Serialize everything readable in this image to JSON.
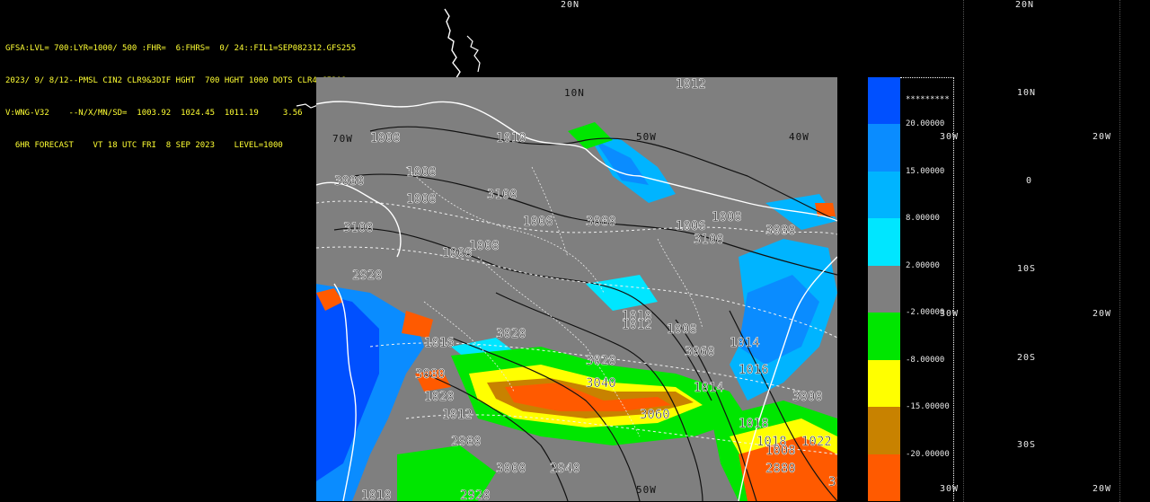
{
  "header": {
    "line1": "GFSA:LVL= 700:LYR=1000/ 500 :FHR=  6:FHRS=  0/ 24::FIL1=SEP082312.GFS255",
    "line2": "2023/ 9/ 8/12--PMSL CIN2 CLR9&3DIF HGHT  700 HGHT 1000 DOTS CLR4 CI20&",
    "line3": "V:WNG-V32    --N/X/MN/SD=  1003.92  1024.45  1011.19     3.56",
    "line4": "  6HR FORECAST    VT 18 UTC FRI  8 SEP 2023    LEVEL=1000"
  },
  "geo_labels": {
    "top_20n_a": "20N",
    "top_20n_b": "20N",
    "map_10n": "10N",
    "map_70w": "70W",
    "map_50w": "50W",
    "map_40w": "40W",
    "map_50w_bottom": "50W",
    "right_10n": "10N",
    "right_30w_a": "30W",
    "right_20w_a": "20W",
    "right_0": "0",
    "right_10s": "10S",
    "right_30w_b": "30W",
    "right_20w_b": "20W",
    "right_20s": "20S",
    "right_30s": "30S",
    "right_30w_c": "30W",
    "right_20w_c": "20W"
  },
  "contour_labels": [
    "1012",
    "1008",
    "1010",
    "1008",
    "1008",
    "1006",
    "3080",
    "3100",
    "1008",
    "3100",
    "1008",
    "3080",
    "1006",
    "3100",
    "1008",
    "3080",
    "3080",
    "1008",
    "3060",
    "1014",
    "1016",
    "1018",
    "1020",
    "1012",
    "2980",
    "3000",
    "3020",
    "3040",
    "2920",
    "3060",
    "1010",
    "1014",
    "1016",
    "1018",
    "3000",
    "1008",
    "3020",
    "2940",
    "1012",
    "2880",
    "2920",
    "1022",
    "3100",
    "1010"
  ],
  "colorbar": {
    "stars": "*********",
    "labels": [
      "20.00000",
      "15.00000",
      "8.00000",
      "2.00000",
      "-2.00000",
      "-8.00000",
      "-15.00000",
      "-20.00000"
    ],
    "colors": [
      "#0050ff",
      "#0a8cff",
      "#00b4ff",
      "#00e6ff",
      "#7f7f7f",
      "#00e600",
      "#ffff00",
      "#c88200",
      "#ff5a00"
    ]
  }
}
